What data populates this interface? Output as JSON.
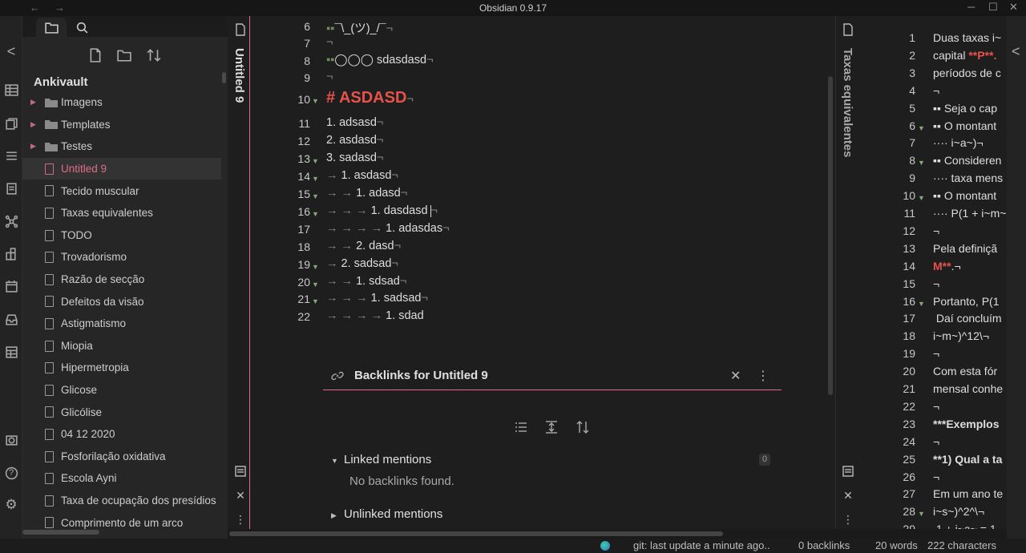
{
  "window": {
    "title": "Obsidian 0.9.17",
    "back_arrow": "←",
    "forward_arrow": "→",
    "minimize": "─",
    "maximize": "☐",
    "close": "✕"
  },
  "ribbon": {
    "collapse": "<",
    "icons": [
      "table-icon",
      "copy-icon",
      "list-icon",
      "document-icon",
      "graph-icon",
      "puzzle-icon",
      "calendar-icon",
      "inbox-icon",
      "database-icon",
      "camera-icon",
      "help-icon",
      "settings-icon"
    ],
    "help_glyph": "?",
    "settings_glyph": "⚙"
  },
  "explorer": {
    "vault_name": "Ankivault",
    "folders": [
      {
        "label": "Imagens"
      },
      {
        "label": "Templates"
      },
      {
        "label": "Testes"
      }
    ],
    "files": [
      {
        "label": "Untitled 9",
        "active": true
      },
      {
        "label": "Tecido muscular"
      },
      {
        "label": "Taxas equivalentes"
      },
      {
        "label": "TODO"
      },
      {
        "label": "Trovadorismo"
      },
      {
        "label": "Razão de secção"
      },
      {
        "label": "Defeitos da visão"
      },
      {
        "label": "Astigmatismo"
      },
      {
        "label": "Miopia"
      },
      {
        "label": "Hipermetropia"
      },
      {
        "label": "Glicose"
      },
      {
        "label": "Glicólise"
      },
      {
        "label": "04 12 2020"
      },
      {
        "label": "Fosforilação oxidativa"
      },
      {
        "label": "Escola Ayni"
      },
      {
        "label": "Taxa de ocupação dos presídios"
      },
      {
        "label": "Comprimento de um arco"
      }
    ]
  },
  "left_pane": {
    "title": "Untitled 9",
    "lines": [
      {
        "n": "6",
        "fold": false,
        "inv": "▪▪",
        "text": "¯\\_(ツ)_/¯",
        "tail": "¬"
      },
      {
        "n": "7",
        "fold": false,
        "inv": "",
        "text": "",
        "tail": "¬"
      },
      {
        "n": "8",
        "fold": false,
        "inv": "▪▪",
        "text": "◯◯◯ sdasdasd",
        "tail": "¬"
      },
      {
        "n": "9",
        "fold": false,
        "inv": "",
        "text": "",
        "tail": "¬"
      },
      {
        "n": "10",
        "fold": true,
        "header": "# ASDASD",
        "tail": "¬"
      },
      {
        "n": "11",
        "fold": false,
        "arrows": "",
        "text": "1. adsasd",
        "tail": "¬"
      },
      {
        "n": "12",
        "fold": false,
        "arrows": "",
        "text": "2. asdasd",
        "tail": "¬"
      },
      {
        "n": "13",
        "fold": true,
        "arrows": "",
        "text": "3. sadasd",
        "tail": "¬"
      },
      {
        "n": "14",
        "fold": true,
        "arrows": "→ ",
        "text": "1. asdasd",
        "tail": "¬"
      },
      {
        "n": "15",
        "fold": true,
        "arrows": "→ → ",
        "text": "1. adasd",
        "tail": "¬"
      },
      {
        "n": "16",
        "fold": true,
        "arrows": "→ → → ",
        "text": "1. dasdasd",
        "tail": "¬",
        "cursor": true
      },
      {
        "n": "17",
        "fold": false,
        "arrows": "→ → → → ",
        "text": "1. adasdas",
        "tail": "¬"
      },
      {
        "n": "18",
        "fold": false,
        "arrows": "→ → ",
        "text": "2. dasd",
        "tail": "¬"
      },
      {
        "n": "19",
        "fold": true,
        "arrows": "→ ",
        "text": "2. sadsad",
        "tail": "¬"
      },
      {
        "n": "20",
        "fold": true,
        "arrows": "→ → ",
        "text": "1. sdsad",
        "tail": "¬"
      },
      {
        "n": "21",
        "fold": true,
        "arrows": "→ → → ",
        "text": "1. sadsad",
        "tail": "¬"
      },
      {
        "n": "22",
        "fold": false,
        "arrows": "→ → → → ",
        "text": "1. sdad",
        "tail": ""
      }
    ],
    "close_glyph": "✕",
    "more_glyph": "⋮"
  },
  "backlinks": {
    "title": "Backlinks for Untitled 9",
    "linked_mentions": "Linked mentions",
    "linked_count": "0",
    "no_backlinks": "No backlinks found.",
    "unlinked_mentions": "Unlinked mentions",
    "close_glyph": "✕",
    "more_glyph": "⋮"
  },
  "right_pane": {
    "title": "Taxas equivalentes",
    "lines": [
      {
        "n": "1",
        "fold": false,
        "text": "Duas taxas i~"
      },
      {
        "n": "2",
        "fold": false,
        "text": "capital ",
        "red": "**P**.",
        "after": ""
      },
      {
        "n": "3",
        "fold": false,
        "text": "períodos de c"
      },
      {
        "n": "4",
        "fold": false,
        "text": "¬"
      },
      {
        "n": "5",
        "fold": false,
        "text": "▪▪ Seja o cap"
      },
      {
        "n": "6",
        "fold": true,
        "text": "▪▪ O montant"
      },
      {
        "n": "7",
        "fold": false,
        "text": "···· i~a~)¬"
      },
      {
        "n": "8",
        "fold": true,
        "text": "▪▪ Consideren"
      },
      {
        "n": "9",
        "fold": false,
        "text": "···· taxa mens"
      },
      {
        "n": "10",
        "fold": true,
        "text": "▪▪ O montant"
      },
      {
        "n": "11",
        "fold": false,
        "text": "···· P(1 + i~m~"
      },
      {
        "n": "12",
        "fold": false,
        "text": "¬"
      },
      {
        "n": "13",
        "fold": false,
        "text": "Pela definiçã"
      },
      {
        "n": "14",
        "fold": false,
        "text": "",
        "red": "M**",
        "after": ".¬"
      },
      {
        "n": "15",
        "fold": false,
        "text": "¬"
      },
      {
        "n": "16",
        "fold": true,
        "text": "Portanto, P(1"
      },
      {
        "n": "17",
        "fold": false,
        "text": " Daí concluím"
      },
      {
        "n": "18",
        "fold": false,
        "text": "i~m~)^12\\¬"
      },
      {
        "n": "19",
        "fold": false,
        "text": "¬"
      },
      {
        "n": "20",
        "fold": false,
        "text": "Com esta fór"
      },
      {
        "n": "21",
        "fold": false,
        "text": "mensal conhe"
      },
      {
        "n": "22",
        "fold": false,
        "text": "¬"
      },
      {
        "n": "23",
        "fold": false,
        "text": "***Exemplos",
        "bold": true
      },
      {
        "n": "24",
        "fold": false,
        "text": "¬"
      },
      {
        "n": "25",
        "fold": false,
        "text": "**1) Qual a ta",
        "bold": true
      },
      {
        "n": "26",
        "fold": false,
        "text": "¬"
      },
      {
        "n": "27",
        "fold": false,
        "text": "Em um ano te"
      },
      {
        "n": "28",
        "fold": true,
        "text": "i~s~)^2^\\¬"
      },
      {
        "n": "29",
        "fold": false,
        "text": " 1 + i~a~ = 1,"
      }
    ],
    "collapse": "<",
    "close_glyph": "✕",
    "more_glyph": "⋮"
  },
  "status": {
    "git": "git: last update a minute ago..",
    "backlinks": "0 backlinks",
    "words": "20 words",
    "characters": "222 characters"
  }
}
